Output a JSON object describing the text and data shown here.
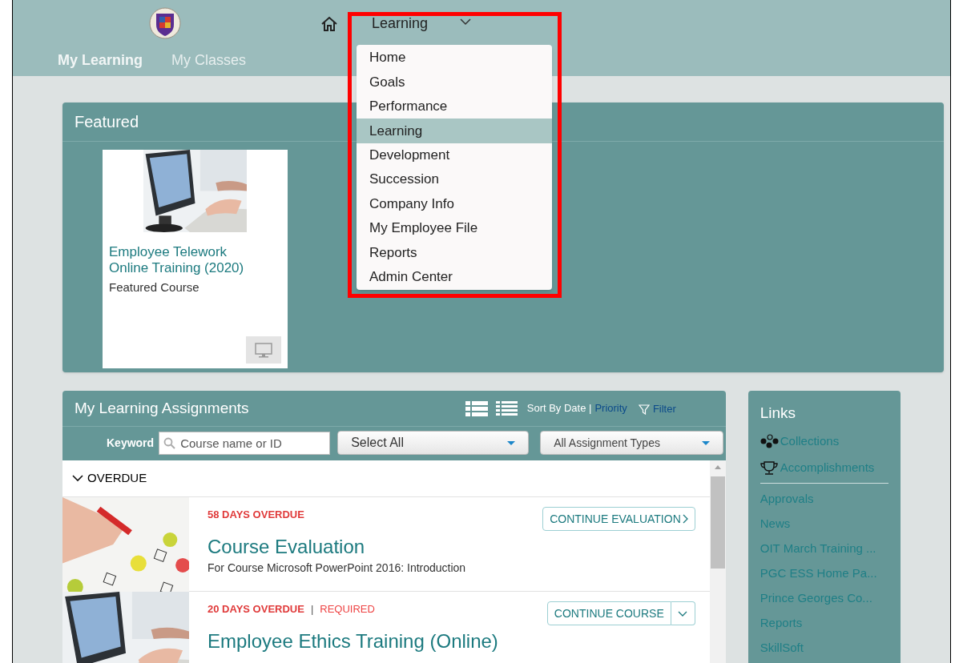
{
  "header": {
    "nav_menu": {
      "label": "Learning",
      "expanded": true,
      "items": [
        {
          "label": "Home",
          "selected": false
        },
        {
          "label": "Goals",
          "selected": false
        },
        {
          "label": "Performance",
          "selected": false
        },
        {
          "label": "Learning",
          "selected": true
        },
        {
          "label": "Development",
          "selected": false
        },
        {
          "label": "Succession",
          "selected": false
        },
        {
          "label": "Company Info",
          "selected": false
        },
        {
          "label": "My Employee File",
          "selected": false
        },
        {
          "label": "Reports",
          "selected": false
        },
        {
          "label": "Admin Center",
          "selected": false
        }
      ]
    },
    "tabs": [
      {
        "label": "My Learning",
        "selected": true
      },
      {
        "label": "My Classes",
        "selected": false
      }
    ]
  },
  "featured": {
    "title": "Featured",
    "cards": [
      {
        "title": "Employee Telework Online Training (2020)",
        "subtitle": "Featured Course"
      }
    ]
  },
  "assignments": {
    "title": "My Learning Assignments",
    "sort_label": "Sort By Date |",
    "sort_link": "Priority",
    "filter": "Filter",
    "keyword_label": "Keyword",
    "search_placeholder": "Course name or ID",
    "select_status": "Select All",
    "select_type": "All Assignment Types",
    "groups": [
      {
        "label": "OVERDUE",
        "expanded": true,
        "items": [
          {
            "status": "58 DAYS OVERDUE",
            "title": "Course Evaluation",
            "description": "For Course Microsoft PowerPoint 2016: Introduction",
            "action": "CONTINUE EVALUATION",
            "has_menu": false
          },
          {
            "status": "20 DAYS OVERDUE",
            "separator": "|",
            "tag": "REQUIRED",
            "title": "Employee Ethics Training (Online)",
            "action": "CONTINUE COURSE",
            "has_menu": true
          }
        ]
      }
    ]
  },
  "links": {
    "title": "Links",
    "icon_links": [
      "Collections",
      "Accomplishments"
    ],
    "items": [
      "Approvals",
      "News",
      "OIT March Training ...",
      "PGC ESS Home Pa...",
      "Prince Georges Co...",
      "Reports",
      "SkillSoft"
    ]
  }
}
